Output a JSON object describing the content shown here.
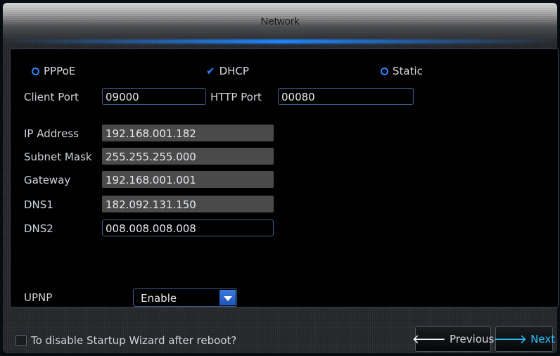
{
  "window": {
    "title": "Network"
  },
  "mode": {
    "options": [
      {
        "label": "PPPoE",
        "selected": false
      },
      {
        "label": "DHCP",
        "selected": true
      },
      {
        "label": "Static",
        "selected": false
      }
    ]
  },
  "ports": {
    "client_port_label": "Client Port",
    "client_port_value": "09000",
    "http_port_label": "HTTP Port",
    "http_port_value": "00080"
  },
  "fields": [
    {
      "label": "IP Address",
      "value": "192.168.001.182",
      "editable": false
    },
    {
      "label": "Subnet Mask",
      "value": "255.255.255.000",
      "editable": false
    },
    {
      "label": "Gateway",
      "value": "192.168.001.001",
      "editable": false
    },
    {
      "label": "DNS1",
      "value": "182.092.131.150",
      "editable": false
    },
    {
      "label": "DNS2",
      "value": "008.008.008.008",
      "editable": true
    }
  ],
  "upnp": {
    "label": "UPNP",
    "value": "Enable"
  },
  "footer": {
    "checkbox_label": "To disable Startup Wizard after reboot?",
    "checkbox_checked": false,
    "previous_label": "Previous",
    "next_label": "Next"
  },
  "colors": {
    "accent": "#2d86ff",
    "next_text": "#29c6ff",
    "disabled_field": "#4a4a4a"
  },
  "icons": {
    "selected_mode": "checkmark-icon",
    "unselected_mode": "radio-circle-icon",
    "previous": "arrow-left-icon",
    "next": "arrow-right-icon"
  }
}
